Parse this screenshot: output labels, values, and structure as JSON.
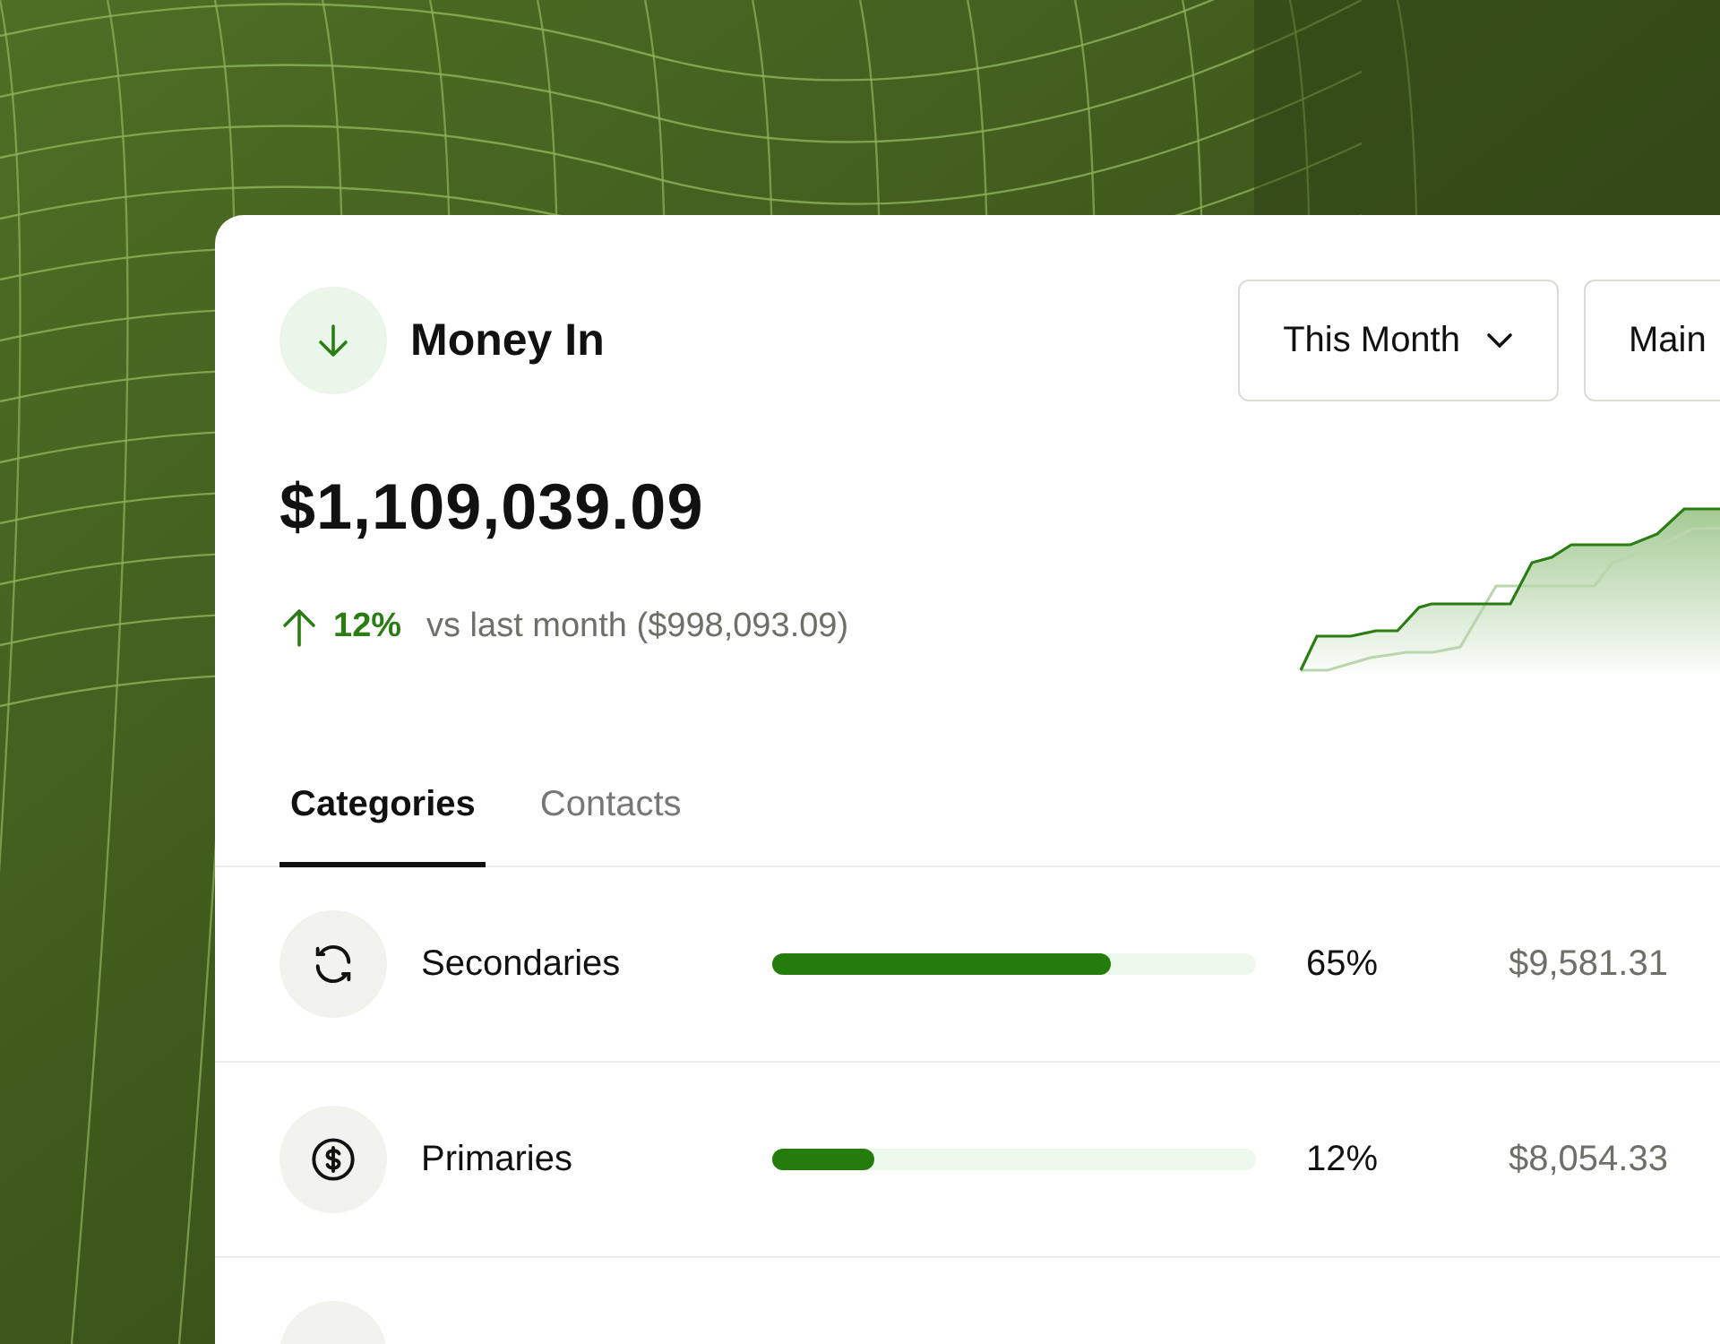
{
  "card": {
    "title": "Money In",
    "filters": [
      {
        "label": "This Month",
        "kind": "dropdown"
      },
      {
        "label": "Main",
        "kind": "cut"
      }
    ],
    "amount": "$1,109,039.09",
    "change": "12%",
    "comparison": "vs last month ($998,093.09)",
    "tabs": [
      {
        "label": "Categories",
        "selected": true
      },
      {
        "label": "Contacts",
        "selected": false
      }
    ],
    "rows": [
      {
        "kind": "refresh",
        "name": "Secondaries",
        "level": 0.7,
        "percent": "65%",
        "amount": "$9,581.31"
      },
      {
        "kind": "dollar",
        "name": "Primaries",
        "level": 0.21,
        "percent": "12%",
        "amount": "$8,054.33"
      },
      {
        "kind": "cut"
      }
    ]
  }
}
